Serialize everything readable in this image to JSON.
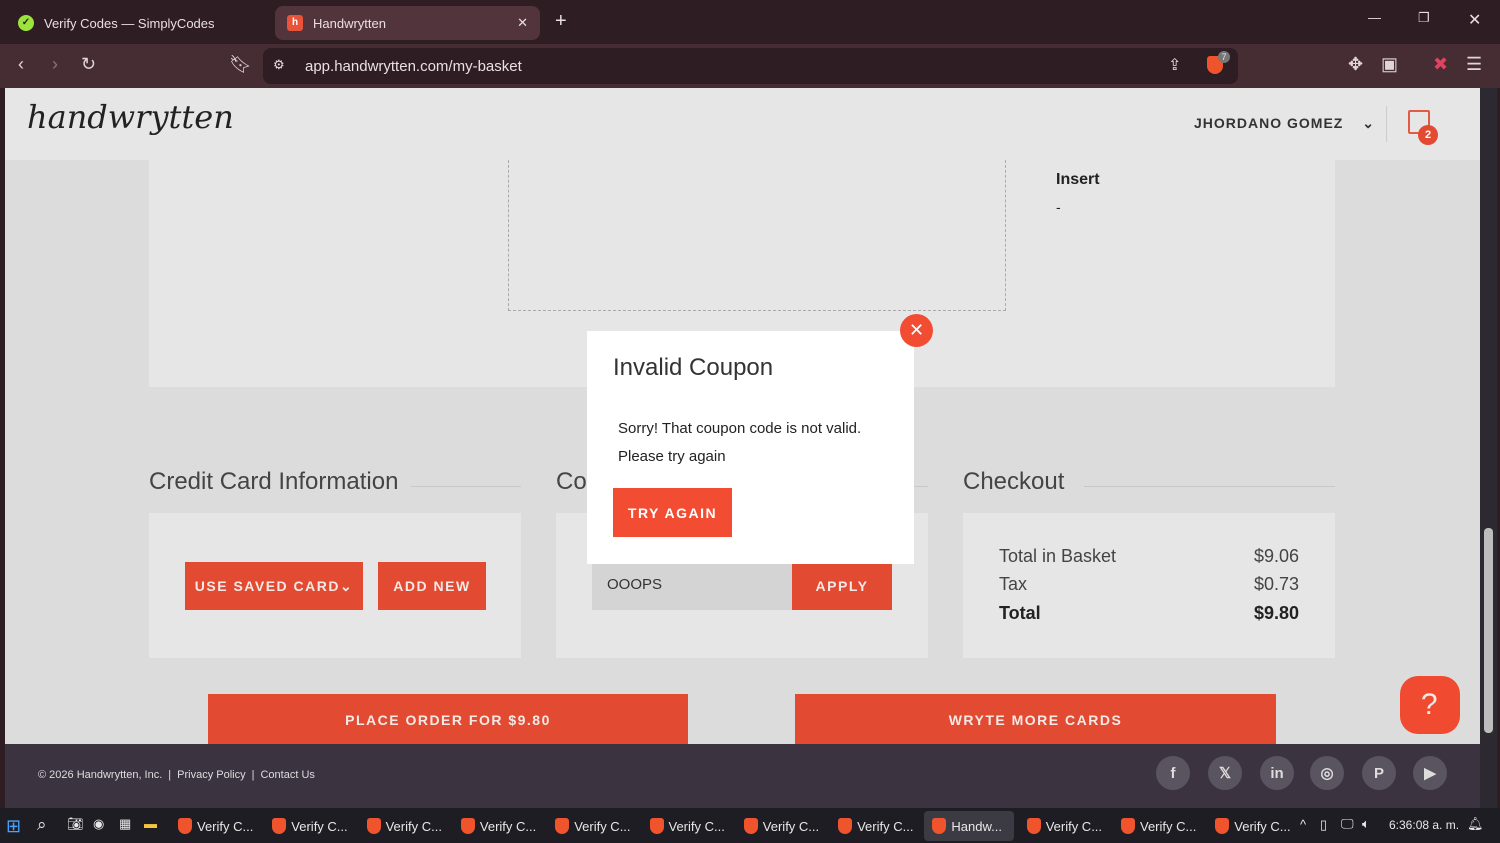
{
  "browser": {
    "tabs": [
      {
        "label": "Verify Codes — SimplyCodes",
        "icon": "simplycodes-icon"
      },
      {
        "label": "Handwrytten",
        "icon": "handwrytten-icon",
        "active": true
      }
    ],
    "url": "app.handwrytten.com/my-basket",
    "brave_badge": "7"
  },
  "header": {
    "logo": "handwrytten",
    "user": "JHORDANO GOMEZ",
    "cart_count": "2"
  },
  "top_card": {
    "insert_label": "Insert",
    "insert_value": "-"
  },
  "credit_card": {
    "title": "Credit Card Information",
    "use_saved": "USE SAVED CARD",
    "add_new": "ADD NEW"
  },
  "coupon": {
    "title": "Co",
    "value": "OOOPS",
    "apply": "APPLY"
  },
  "checkout": {
    "title": "Checkout",
    "rows": [
      {
        "label": "Total in Basket",
        "value": "$9.06"
      },
      {
        "label": "Tax",
        "value": "$0.73"
      },
      {
        "label": "Total",
        "value": "$9.80"
      }
    ]
  },
  "actions": {
    "place_order": "PLACE ORDER FOR $9.80",
    "wryte_more": "WRYTE MORE CARDS"
  },
  "help": "?",
  "modal": {
    "title": "Invalid Coupon",
    "line1": "Sorry! That coupon code is not valid.",
    "line2": "Please try again",
    "button": "TRY AGAIN"
  },
  "footer": {
    "copyright": "© 2026 Handwrytten, Inc.",
    "privacy": "Privacy Policy",
    "contact": "Contact Us",
    "social": [
      "f",
      "𝕏",
      "in",
      "◎",
      "P",
      "▶"
    ]
  },
  "taskbar": {
    "items": [
      "Verify C...",
      "Verify C...",
      "Verify C...",
      "Verify C...",
      "Verify C...",
      "Verify C...",
      "Verify C...",
      "Verify C...",
      "Handw...",
      "Verify C...",
      "Verify C...",
      "Verify C..."
    ],
    "active_index": 8,
    "clock": "6:36:08 a. m."
  },
  "colors": {
    "accent": "#e34a32",
    "footer": "#3b3440"
  }
}
